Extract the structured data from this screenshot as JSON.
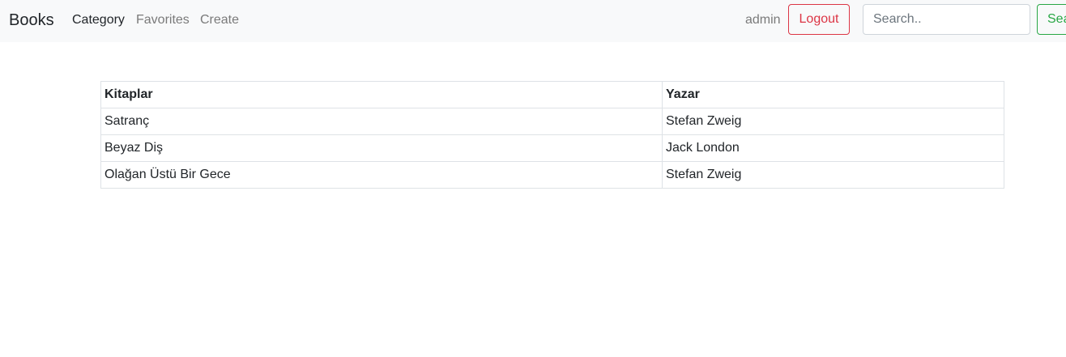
{
  "navbar": {
    "brand": "Books",
    "links": [
      {
        "label": "Category",
        "active": true
      },
      {
        "label": "Favorites",
        "active": false
      },
      {
        "label": "Create",
        "active": false
      }
    ],
    "user": "admin",
    "logout_label": "Logout",
    "search_placeholder": "Search..",
    "search_button_label": "Search"
  },
  "table": {
    "headers": [
      "Kitaplar",
      "Yazar"
    ],
    "rows": [
      [
        "Satranç",
        "Stefan Zweig"
      ],
      [
        "Beyaz Diş",
        "Jack London"
      ],
      [
        "Olağan Üstü Bir Gece",
        "Stefan Zweig"
      ]
    ]
  },
  "colors": {
    "navbar_bg": "#f8f9fa",
    "danger": "#dc3545",
    "success": "#28a745",
    "border": "#dee2e6"
  }
}
